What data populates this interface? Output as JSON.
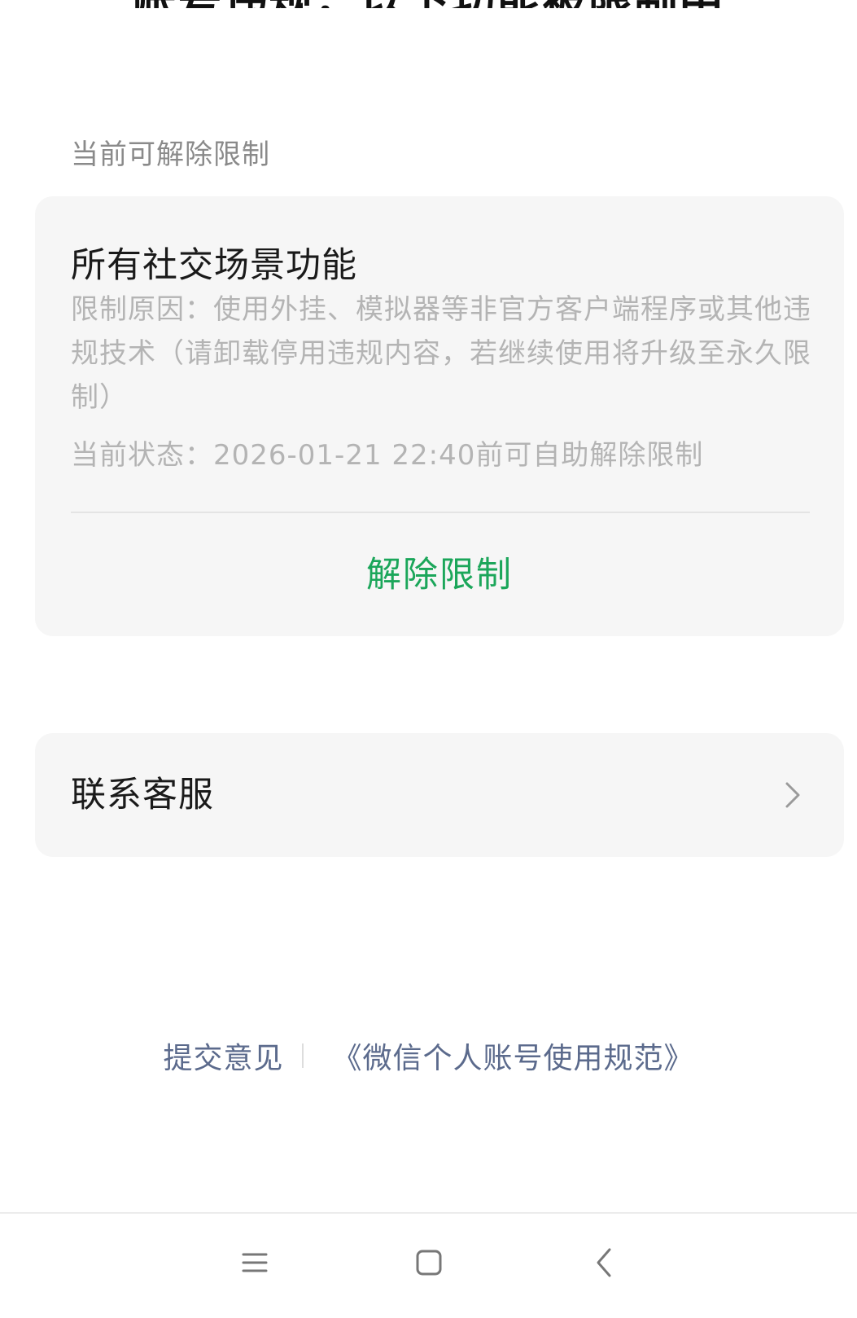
{
  "header": {
    "title": "账号违规，以下功能被限制中"
  },
  "section": {
    "label": "当前可解除限制"
  },
  "restriction_card": {
    "title": "所有社交场景功能",
    "reason": "限制原因：使用外挂、模拟器等非官方客户端程序或其他违规技术（请卸载停用违规内容，若继续使用将升级至永久限制）",
    "status": "当前状态：2026-01-21 22:40前可自助解除限制",
    "unlock_label": "解除限制",
    "accent_color": "#1ba65a"
  },
  "service_card": {
    "label": "联系客服",
    "icon": "chevron-right-icon"
  },
  "footer": {
    "feedback_label": "提交意见",
    "policy_label": "《微信个人账号使用规范》",
    "link_color": "#5b6a8c"
  },
  "nav": {
    "menu_icon": "menu-icon",
    "home_icon": "home-square-icon",
    "back_icon": "back-chevron-icon"
  }
}
